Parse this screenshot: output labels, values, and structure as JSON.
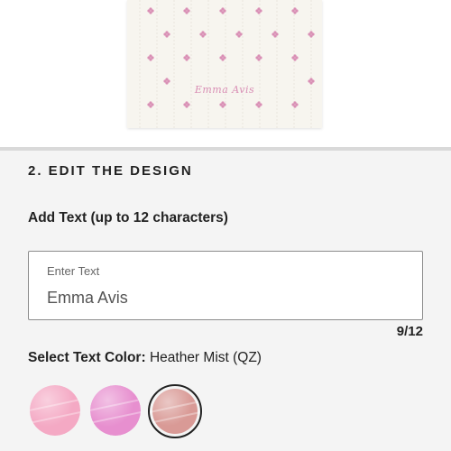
{
  "preview": {
    "monogram_text": "Emma Avis",
    "blanket_color": "#f7f5ef",
    "flower_color": "#d98fb5"
  },
  "editor": {
    "section_title": "2. EDIT THE DESIGN",
    "add_text_label": "Add Text (up to 12 characters)",
    "text_field": {
      "label": "Enter Text",
      "value": "Emma Avis"
    },
    "char_count": "9/12",
    "color_label_prefix": "Select Text Color:",
    "color_label_value": "Heather Mist (QZ)",
    "swatches": [
      {
        "name": "light-pink-thread",
        "color": "#f4a9c4",
        "selected": false
      },
      {
        "name": "pink-thread",
        "color": "#e78fcf",
        "selected": false
      },
      {
        "name": "heather-mist-thread",
        "color": "#d99a96",
        "selected": true
      }
    ]
  }
}
